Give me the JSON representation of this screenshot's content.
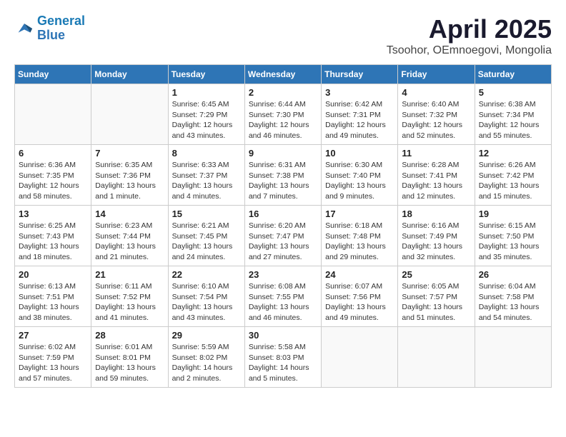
{
  "header": {
    "logo_general": "General",
    "logo_blue": "Blue",
    "title": "April 2025",
    "subtitle": "Tsoohor, OEmnoegovi, Mongolia"
  },
  "weekdays": [
    "Sunday",
    "Monday",
    "Tuesday",
    "Wednesday",
    "Thursday",
    "Friday",
    "Saturday"
  ],
  "weeks": [
    [
      {
        "day": "",
        "info": ""
      },
      {
        "day": "",
        "info": ""
      },
      {
        "day": "1",
        "info": "Sunrise: 6:45 AM\nSunset: 7:29 PM\nDaylight: 12 hours and 43 minutes."
      },
      {
        "day": "2",
        "info": "Sunrise: 6:44 AM\nSunset: 7:30 PM\nDaylight: 12 hours and 46 minutes."
      },
      {
        "day": "3",
        "info": "Sunrise: 6:42 AM\nSunset: 7:31 PM\nDaylight: 12 hours and 49 minutes."
      },
      {
        "day": "4",
        "info": "Sunrise: 6:40 AM\nSunset: 7:32 PM\nDaylight: 12 hours and 52 minutes."
      },
      {
        "day": "5",
        "info": "Sunrise: 6:38 AM\nSunset: 7:34 PM\nDaylight: 12 hours and 55 minutes."
      }
    ],
    [
      {
        "day": "6",
        "info": "Sunrise: 6:36 AM\nSunset: 7:35 PM\nDaylight: 12 hours and 58 minutes."
      },
      {
        "day": "7",
        "info": "Sunrise: 6:35 AM\nSunset: 7:36 PM\nDaylight: 13 hours and 1 minute."
      },
      {
        "day": "8",
        "info": "Sunrise: 6:33 AM\nSunset: 7:37 PM\nDaylight: 13 hours and 4 minutes."
      },
      {
        "day": "9",
        "info": "Sunrise: 6:31 AM\nSunset: 7:38 PM\nDaylight: 13 hours and 7 minutes."
      },
      {
        "day": "10",
        "info": "Sunrise: 6:30 AM\nSunset: 7:40 PM\nDaylight: 13 hours and 9 minutes."
      },
      {
        "day": "11",
        "info": "Sunrise: 6:28 AM\nSunset: 7:41 PM\nDaylight: 13 hours and 12 minutes."
      },
      {
        "day": "12",
        "info": "Sunrise: 6:26 AM\nSunset: 7:42 PM\nDaylight: 13 hours and 15 minutes."
      }
    ],
    [
      {
        "day": "13",
        "info": "Sunrise: 6:25 AM\nSunset: 7:43 PM\nDaylight: 13 hours and 18 minutes."
      },
      {
        "day": "14",
        "info": "Sunrise: 6:23 AM\nSunset: 7:44 PM\nDaylight: 13 hours and 21 minutes."
      },
      {
        "day": "15",
        "info": "Sunrise: 6:21 AM\nSunset: 7:45 PM\nDaylight: 13 hours and 24 minutes."
      },
      {
        "day": "16",
        "info": "Sunrise: 6:20 AM\nSunset: 7:47 PM\nDaylight: 13 hours and 27 minutes."
      },
      {
        "day": "17",
        "info": "Sunrise: 6:18 AM\nSunset: 7:48 PM\nDaylight: 13 hours and 29 minutes."
      },
      {
        "day": "18",
        "info": "Sunrise: 6:16 AM\nSunset: 7:49 PM\nDaylight: 13 hours and 32 minutes."
      },
      {
        "day": "19",
        "info": "Sunrise: 6:15 AM\nSunset: 7:50 PM\nDaylight: 13 hours and 35 minutes."
      }
    ],
    [
      {
        "day": "20",
        "info": "Sunrise: 6:13 AM\nSunset: 7:51 PM\nDaylight: 13 hours and 38 minutes."
      },
      {
        "day": "21",
        "info": "Sunrise: 6:11 AM\nSunset: 7:52 PM\nDaylight: 13 hours and 41 minutes."
      },
      {
        "day": "22",
        "info": "Sunrise: 6:10 AM\nSunset: 7:54 PM\nDaylight: 13 hours and 43 minutes."
      },
      {
        "day": "23",
        "info": "Sunrise: 6:08 AM\nSunset: 7:55 PM\nDaylight: 13 hours and 46 minutes."
      },
      {
        "day": "24",
        "info": "Sunrise: 6:07 AM\nSunset: 7:56 PM\nDaylight: 13 hours and 49 minutes."
      },
      {
        "day": "25",
        "info": "Sunrise: 6:05 AM\nSunset: 7:57 PM\nDaylight: 13 hours and 51 minutes."
      },
      {
        "day": "26",
        "info": "Sunrise: 6:04 AM\nSunset: 7:58 PM\nDaylight: 13 hours and 54 minutes."
      }
    ],
    [
      {
        "day": "27",
        "info": "Sunrise: 6:02 AM\nSunset: 7:59 PM\nDaylight: 13 hours and 57 minutes."
      },
      {
        "day": "28",
        "info": "Sunrise: 6:01 AM\nSunset: 8:01 PM\nDaylight: 13 hours and 59 minutes."
      },
      {
        "day": "29",
        "info": "Sunrise: 5:59 AM\nSunset: 8:02 PM\nDaylight: 14 hours and 2 minutes."
      },
      {
        "day": "30",
        "info": "Sunrise: 5:58 AM\nSunset: 8:03 PM\nDaylight: 14 hours and 5 minutes."
      },
      {
        "day": "",
        "info": ""
      },
      {
        "day": "",
        "info": ""
      },
      {
        "day": "",
        "info": ""
      }
    ]
  ]
}
